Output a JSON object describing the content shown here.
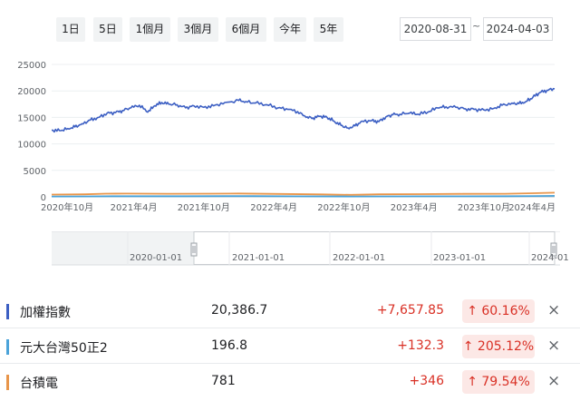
{
  "range_buttons": [
    "1日",
    "5日",
    "1個月",
    "3個月",
    "6個月",
    "今年",
    "5年"
  ],
  "date_range": {
    "start": "2020-08-31",
    "separator": "~",
    "end": "2024-04-03"
  },
  "chart_data": {
    "type": "line",
    "y_ticks": [
      "25000",
      "20000",
      "15000",
      "10000",
      "5000",
      "0"
    ],
    "y_tick_values": [
      25000,
      20000,
      15000,
      10000,
      5000,
      0
    ],
    "ylim": [
      0,
      25000
    ],
    "x_tick_labels": [
      "2020年10月",
      "2021年4月",
      "2021年10月",
      "2022年4月",
      "2022年10月",
      "2023年4月",
      "2023年10月",
      "2024年4月"
    ],
    "x_tick_times": [
      2020.75,
      2021.25,
      2021.75,
      2022.25,
      2022.75,
      2023.25,
      2023.75,
      2024.25
    ],
    "xlim": [
      2020.664,
      2024.255
    ],
    "series": [
      {
        "name": "加權指數",
        "color": "#3c5fc3",
        "points": [
          [
            2020.664,
            12600
          ],
          [
            2020.72,
            12500
          ],
          [
            2020.78,
            12900
          ],
          [
            2020.83,
            13200
          ],
          [
            2020.88,
            13800
          ],
          [
            2020.94,
            14500
          ],
          [
            2021.0,
            15000
          ],
          [
            2021.06,
            15800
          ],
          [
            2021.12,
            15900
          ],
          [
            2021.17,
            16300
          ],
          [
            2021.23,
            16800
          ],
          [
            2021.29,
            17300
          ],
          [
            2021.35,
            16000
          ],
          [
            2021.4,
            17200
          ],
          [
            2021.45,
            17800
          ],
          [
            2021.5,
            17500
          ],
          [
            2021.56,
            17400
          ],
          [
            2021.62,
            16800
          ],
          [
            2021.68,
            17200
          ],
          [
            2021.75,
            16900
          ],
          [
            2021.82,
            17200
          ],
          [
            2021.9,
            17800
          ],
          [
            2022.0,
            18200
          ],
          [
            2022.05,
            18000
          ],
          [
            2022.12,
            17700
          ],
          [
            2022.2,
            17400
          ],
          [
            2022.28,
            16800
          ],
          [
            2022.35,
            16500
          ],
          [
            2022.42,
            16100
          ],
          [
            2022.48,
            15000
          ],
          [
            2022.53,
            14900
          ],
          [
            2022.58,
            15200
          ],
          [
            2022.63,
            15000
          ],
          [
            2022.68,
            14300
          ],
          [
            2022.73,
            13500
          ],
          [
            2022.78,
            13000
          ],
          [
            2022.83,
            13400
          ],
          [
            2022.88,
            14300
          ],
          [
            2022.95,
            14400
          ],
          [
            2023.0,
            14200
          ],
          [
            2023.05,
            15100
          ],
          [
            2023.1,
            15500
          ],
          [
            2023.15,
            15600
          ],
          [
            2023.22,
            15800
          ],
          [
            2023.28,
            15600
          ],
          [
            2023.35,
            16000
          ],
          [
            2023.42,
            16800
          ],
          [
            2023.48,
            17000
          ],
          [
            2023.55,
            16900
          ],
          [
            2023.62,
            16600
          ],
          [
            2023.68,
            16500
          ],
          [
            2023.75,
            16400
          ],
          [
            2023.82,
            16700
          ],
          [
            2023.88,
            17300
          ],
          [
            2023.95,
            17700
          ],
          [
            2024.0,
            17600
          ],
          [
            2024.05,
            18000
          ],
          [
            2024.1,
            18800
          ],
          [
            2024.15,
            19700
          ],
          [
            2024.2,
            20100
          ],
          [
            2024.255,
            20386.7
          ]
        ]
      },
      {
        "name": "元大台灣50正2",
        "color": "#4ba3d9",
        "points": [
          [
            2020.664,
            64
          ],
          [
            2020.9,
            85
          ],
          [
            2021.1,
            115
          ],
          [
            2021.3,
            125
          ],
          [
            2021.6,
            122
          ],
          [
            2021.9,
            135
          ],
          [
            2022.1,
            140
          ],
          [
            2022.4,
            110
          ],
          [
            2022.8,
            72
          ],
          [
            2023.0,
            80
          ],
          [
            2023.3,
            100
          ],
          [
            2023.6,
            110
          ],
          [
            2023.9,
            120
          ],
          [
            2024.1,
            160
          ],
          [
            2024.255,
            196.8
          ]
        ]
      },
      {
        "name": "台積電",
        "color": "#e8954a",
        "points": [
          [
            2020.664,
            435
          ],
          [
            2020.9,
            480
          ],
          [
            2021.05,
            600
          ],
          [
            2021.2,
            620
          ],
          [
            2021.5,
            590
          ],
          [
            2021.8,
            595
          ],
          [
            2022.0,
            640
          ],
          [
            2022.3,
            540
          ],
          [
            2022.6,
            460
          ],
          [
            2022.8,
            380
          ],
          [
            2023.0,
            480
          ],
          [
            2023.3,
            520
          ],
          [
            2023.6,
            560
          ],
          [
            2023.9,
            580
          ],
          [
            2024.1,
            690
          ],
          [
            2024.255,
            781
          ]
        ]
      }
    ]
  },
  "navigator": {
    "labels": [
      "2020-01-01",
      "2021-01-01",
      "2022-01-01",
      "2023-01-01",
      "2024-01"
    ]
  },
  "legend": [
    {
      "name": "加權指數",
      "value": "20,386.7",
      "change": "+7,657.85",
      "pct": "↑ 60.16%",
      "color": "#3c5fc3"
    },
    {
      "name": "元大台灣50正2",
      "value": "196.8",
      "change": "+132.3",
      "pct": "↑ 205.12%",
      "color": "#4ba3d9"
    },
    {
      "name": "台積電",
      "value": "781",
      "change": "+346",
      "pct": "↑ 79.54%",
      "color": "#e8954a"
    }
  ],
  "close_icon": "×"
}
